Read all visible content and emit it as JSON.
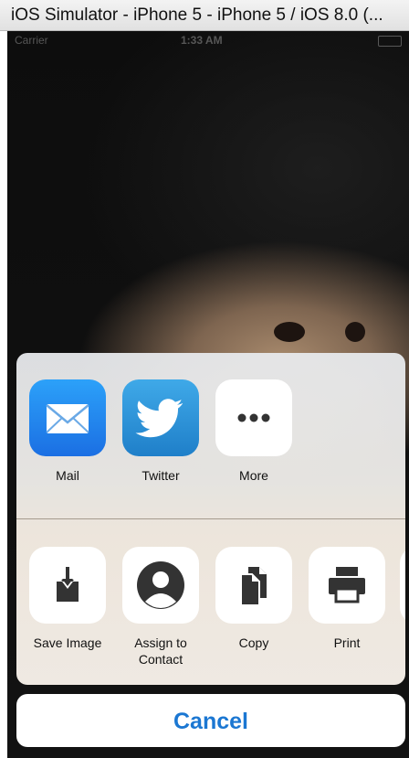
{
  "window": {
    "title": "iOS Simulator - iPhone 5 - iPhone 5 / iOS 8.0 (..."
  },
  "statusbar": {
    "carrier": "Carrier",
    "time": "1:33 AM"
  },
  "share_sheet": {
    "apps": [
      {
        "label": "Mail",
        "icon": "mail-icon"
      },
      {
        "label": "Twitter",
        "icon": "twitter-icon"
      },
      {
        "label": "More",
        "icon": "more-icon"
      }
    ],
    "actions": [
      {
        "label": "Save Image",
        "icon": "save-image-icon"
      },
      {
        "label": "Assign to Contact",
        "icon": "contact-icon"
      },
      {
        "label": "Copy",
        "icon": "copy-icon"
      },
      {
        "label": "Print",
        "icon": "print-icon"
      }
    ],
    "cancel_label": "Cancel"
  },
  "colors": {
    "accent": "#1b77d2",
    "mail_icon_bg": "#1b6fe3",
    "twitter_icon_bg": "#1f7fc9"
  }
}
